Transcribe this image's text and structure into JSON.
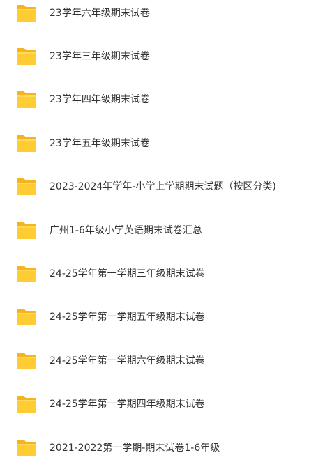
{
  "colors": {
    "folder_back": "#F5B41E",
    "folder_front": "#FFCC33",
    "folder_front_highlight": "#FFD95A",
    "text": "#333333",
    "background": "#FFFFFF"
  },
  "folder_icon": "folder-icon",
  "folders": [
    {
      "name": "23学年六年级期末试卷"
    },
    {
      "name": "23学年三年级期末试卷"
    },
    {
      "name": "23学年四年级期末试卷"
    },
    {
      "name": "23学年五年级期末试卷"
    },
    {
      "name": "2023-2024年学年-小学上学期期末试题（按区分类)"
    },
    {
      "name": "广州1-6年级小学英语期末试卷汇总"
    },
    {
      "name": "24-25学年第一学期三年级期末试卷"
    },
    {
      "name": "24-25学年第一学期五年级期末试卷"
    },
    {
      "name": "24-25学年第一学期六年级期末试卷"
    },
    {
      "name": "24-25学年第一学期四年级期末试卷"
    },
    {
      "name": "2021-2022第一学期-期末试卷1-6年级"
    }
  ]
}
